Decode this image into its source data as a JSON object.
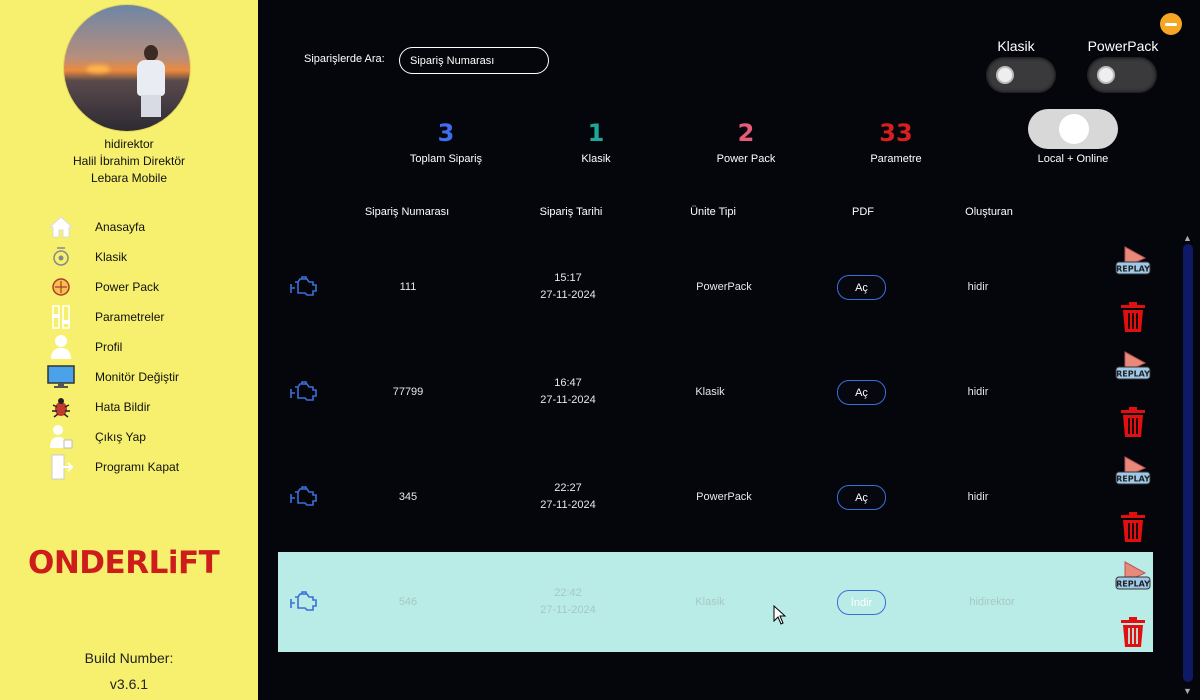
{
  "user": {
    "username": "hidirektor",
    "title": "Halil İbrahim Direktör",
    "company": "Lebara Mobile"
  },
  "sidebar": {
    "items": [
      {
        "label": "Anasayfa",
        "icon": "home-icon"
      },
      {
        "label": "Klasik",
        "icon": "klasik-icon"
      },
      {
        "label": "Power Pack",
        "icon": "power-pack-icon"
      },
      {
        "label": "Parametreler",
        "icon": "parameters-icon"
      },
      {
        "label": "Profil",
        "icon": "profile-icon"
      },
      {
        "label": "Monitör Değiştir",
        "icon": "monitor-icon"
      },
      {
        "label": "Hata Bildir",
        "icon": "bug-icon"
      },
      {
        "label": "Çıkış Yap",
        "icon": "logout-icon"
      },
      {
        "label": "Programı Kapat",
        "icon": "exit-icon"
      }
    ],
    "logo_text_1": "ONDERL",
    "logo_text_2": "i",
    "logo_text_3": "FT",
    "build_label": "Build Number:",
    "build_version": "v3.6.1"
  },
  "search": {
    "label": "Siparişlerde Ara:",
    "placeholder": "Sipariş Numarası"
  },
  "toggles": {
    "klasik_label": "Klasik",
    "powerpack_label": "PowerPack",
    "local_online_label": "Local + Online"
  },
  "stats": [
    {
      "value": "3",
      "label": "Toplam Sipariş",
      "color": "#3d6ef0"
    },
    {
      "value": "1",
      "label": "Klasik",
      "color": "#1ea89a"
    },
    {
      "value": "2",
      "label": "Power Pack",
      "color": "#e85c7a"
    },
    {
      "value": "33",
      "label": "Parametre",
      "color": "#d81e1e"
    }
  ],
  "table": {
    "headers": [
      "Sipariş Numarası",
      "Sipariş Tarihi",
      "Ünite Tipi",
      "PDF",
      "Oluşturan"
    ],
    "rows": [
      {
        "order_no": "111",
        "time": "15:17",
        "date": "27-11-2024",
        "unit_type": "PowerPack",
        "pdf_label": "Aç",
        "creator": "hidir",
        "selected": false
      },
      {
        "order_no": "77799",
        "time": "16:47",
        "date": "27-11-2024",
        "unit_type": "Klasik",
        "pdf_label": "Aç",
        "creator": "hidir",
        "selected": false
      },
      {
        "order_no": "345",
        "time": "22:27",
        "date": "27-11-2024",
        "unit_type": "PowerPack",
        "pdf_label": "Aç",
        "creator": "hidir",
        "selected": false
      },
      {
        "order_no": "546",
        "time": "22:42",
        "date": "27-11-2024",
        "unit_type": "Klasik",
        "pdf_label": "İndir",
        "creator": "hidirektor",
        "selected": true
      }
    ],
    "replay_label": "REPLAY"
  },
  "colors": {
    "sidebar_bg": "#f6f06e",
    "main_bg": "#05050c",
    "selected_row": "#b9ece6",
    "accent_blue": "#3b6fd8",
    "trash_red": "#e01010",
    "close_button": "#f5a623"
  }
}
